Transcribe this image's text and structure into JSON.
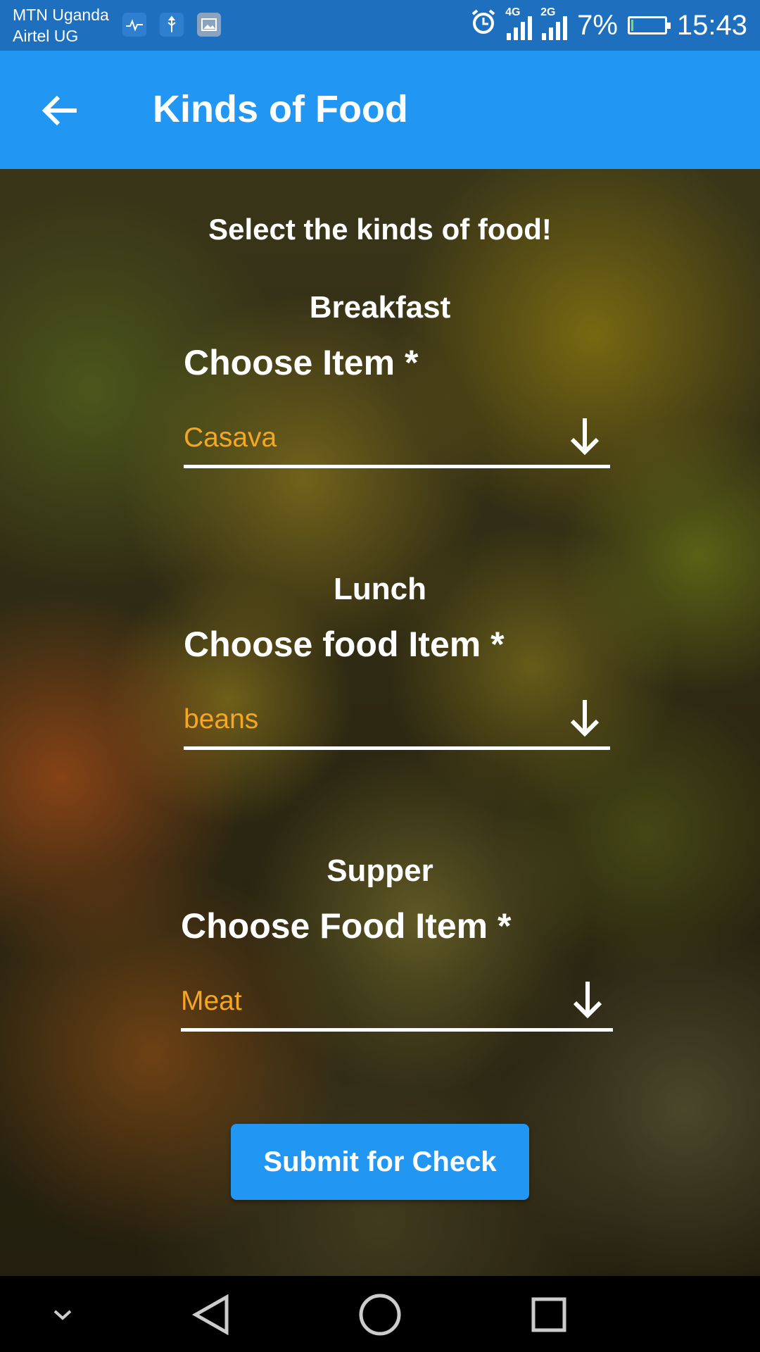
{
  "status_bar": {
    "carrier_1": "MTN Uganda",
    "carrier_2": "Airtel UG",
    "notification_icons": [
      "health-monitor-icon",
      "usb-icon",
      "image-icon"
    ],
    "network_1": "4G",
    "network_2": "2G",
    "battery_percent": "7%",
    "battery_level": 0.07,
    "time": "15:43"
  },
  "app_bar": {
    "title": "Kinds of Food",
    "back_icon": "arrow-left-icon"
  },
  "form": {
    "heading": "Select the kinds of food!",
    "meals": [
      {
        "meal": "Breakfast",
        "label": "Choose Item *",
        "value": "Casava"
      },
      {
        "meal": "Lunch",
        "label": "Choose food Item *",
        "value": "beans"
      },
      {
        "meal": "Supper",
        "label": "Choose Food Item *",
        "value": "Meat"
      }
    ],
    "dropdown_icon": "arrow-down-icon",
    "submit_label": "Submit for Check"
  },
  "colors": {
    "app_bar": "#2196f3",
    "status_bar": "#1f6fbf",
    "dropdown_value": "#f5a623",
    "button": "#2196f3"
  },
  "nav_bar": {
    "icons": [
      "chevron-down-icon",
      "back-triangle-icon",
      "home-circle-icon",
      "recents-square-icon"
    ]
  }
}
